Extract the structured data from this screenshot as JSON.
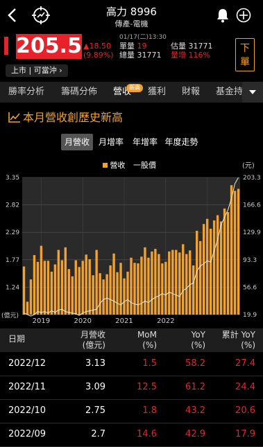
{
  "header": {
    "title": "高力 8996",
    "subtitle": "傳產-電機"
  },
  "quote": {
    "price": "205.5",
    "change": "▲18.50",
    "change_pct": "(9.89%)",
    "datetime": "01/17(二)13:30",
    "single_vol_label": "單量",
    "single_vol": "19",
    "est_vol_label": "估量",
    "est_vol": "31771",
    "total_vol_label": "總量",
    "total_vol": "31771",
    "vol_up_label": "量增",
    "vol_up": "116%",
    "order_button": "下單",
    "market_tag": "上市 | 可當沖"
  },
  "tabs": [
    "勝率分析",
    "籌碼分佈",
    "營收",
    "獲利",
    "財報",
    "基金持"
  ],
  "active_tab": "營收",
  "new_badge": "新高",
  "headline": "本月營收創歷史新高",
  "subtabs": [
    "月營收",
    "月增率",
    "年增率",
    "年度走勢"
  ],
  "chart_data": {
    "type": "bar",
    "legend": [
      "營收",
      "一股價"
    ],
    "unit": "(元)",
    "left_unit": "(億元)",
    "y_left_ticks": [
      "3.35",
      "2.82",
      "2.29",
      "1.77",
      "1.24"
    ],
    "y_right_ticks": [
      "203.3",
      "166.6",
      "129.9",
      "93.3",
      "56.6",
      "19.9"
    ],
    "x_labels": [
      "2019",
      "2020",
      "2021",
      "2022"
    ],
    "ylim": [
      0.7,
      3.35
    ],
    "values": [
      1.63,
      0.95,
      1.38,
      1.85,
      1.72,
      2.03,
      1.74,
      1.74,
      1.53,
      1.67,
      1.95,
      1.75,
      2.0,
      1.58,
      1.44,
      1.75,
      1.62,
      1.74,
      1.86,
      1.77,
      1.46,
      1.95,
      1.5,
      1.38,
      1.48,
      1.65,
      1.88,
      1.52,
      1.7,
      1.4,
      1.53,
      1.8,
      1.7,
      1.69,
      1.82,
      2.0,
      1.8,
      1.92,
      1.97,
      1.87,
      1.69,
      1.72,
      1.92,
      1.95,
      1.95,
      1.9,
      2.06,
      1.87,
      1.94,
      1.65,
      2.32,
      2.12,
      2.45,
      2.55,
      2.36,
      2.52,
      2.62,
      2.5,
      2.75,
      2.68,
      3.2,
      3.09,
      3.13
    ],
    "price_line": [
      22,
      20,
      18,
      20,
      24,
      23,
      24,
      22,
      25,
      23,
      26,
      27,
      24,
      23,
      22,
      21,
      19,
      22,
      24,
      25,
      26,
      27,
      35,
      40,
      42,
      40,
      38,
      35,
      33,
      37,
      40,
      36,
      34,
      33,
      35,
      38,
      36,
      40,
      43,
      45,
      48,
      46,
      50,
      48,
      46,
      44,
      52,
      55,
      60,
      62,
      78,
      85,
      88,
      92,
      90,
      105,
      120,
      140,
      150,
      160,
      175,
      195,
      203
    ]
  },
  "table": {
    "headers": [
      {
        "l1": "日期",
        "l2": ""
      },
      {
        "l1": "月營收",
        "l2": "(億元)"
      },
      {
        "l1": "MoM",
        "l2": "(%)"
      },
      {
        "l1": "YoY",
        "l2": "(%)"
      },
      {
        "l1": "累計 YoY",
        "l2": "(%)"
      }
    ],
    "rows": [
      {
        "date": "2022/12",
        "rev": "3.13",
        "mom": "1.5",
        "yoy": "58.2",
        "cum": "27.4"
      },
      {
        "date": "2022/11",
        "rev": "3.09",
        "mom": "12.5",
        "yoy": "61.2",
        "cum": "24.4"
      },
      {
        "date": "2022/10",
        "rev": "2.75",
        "mom": "1.8",
        "yoy": "43.2",
        "cum": "20.6"
      },
      {
        "date": "2022/09",
        "rev": "2.7",
        "mom": "14.6",
        "yoy": "42.9",
        "cum": "17.9"
      }
    ]
  },
  "colors": {
    "accent": "#f2a22c",
    "up": "#e8222a",
    "bg": "#000000"
  }
}
